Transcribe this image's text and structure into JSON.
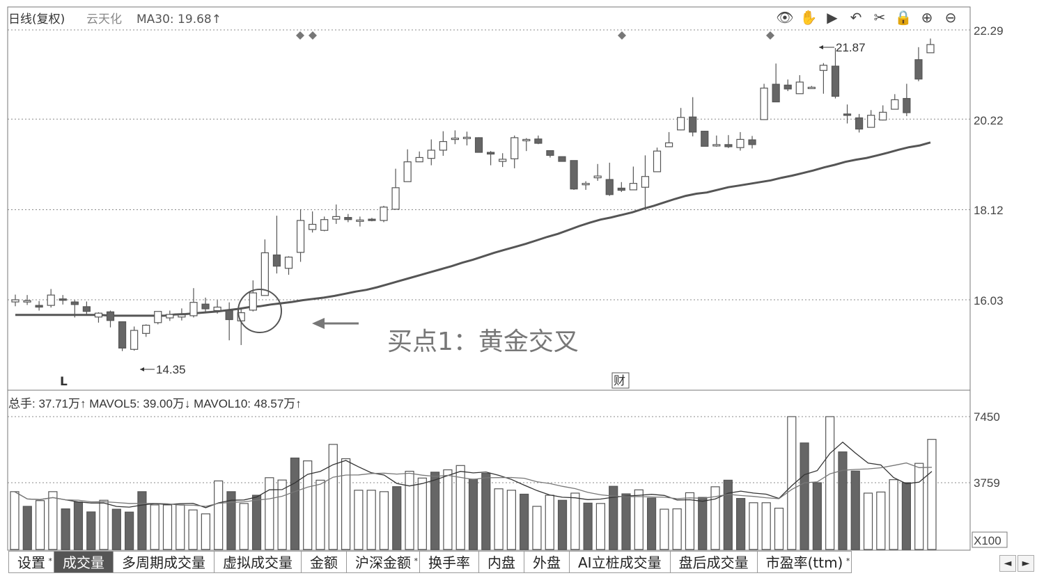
{
  "header": {
    "title": "日线(复权)",
    "stock": "云天化",
    "ma": "MA30: 19.68↑"
  },
  "toolbar": [
    {
      "name": "eye-icon",
      "glyph": "👁"
    },
    {
      "name": "hand-icon",
      "glyph": "✋"
    },
    {
      "name": "play-icon",
      "glyph": "▶"
    },
    {
      "name": "undo-icon",
      "glyph": "↶"
    },
    {
      "name": "scissors-icon",
      "glyph": "✂"
    },
    {
      "name": "lock-icon",
      "glyph": "🔒"
    },
    {
      "name": "zoom-in-icon",
      "glyph": "⊕"
    },
    {
      "name": "zoom-out-icon",
      "glyph": "⊖"
    }
  ],
  "price_axis": [
    "22.29",
    "20.22",
    "18.12",
    "16.03"
  ],
  "volume_axis": [
    "7450",
    "3759"
  ],
  "volume_unit": "X100",
  "annotations": {
    "high": "21.87",
    "low": "14.35",
    "buy_point": "买点1：黄金交叉",
    "marker_l": "L",
    "marker_cai": "财"
  },
  "volume_header": "总手: 37.71万↑ MAVOL5: 39.00万↓ MAVOL10: 48.57万↑",
  "tabs": [
    {
      "label": "设置",
      "star": "*",
      "active": false
    },
    {
      "label": "成交量",
      "star": "",
      "active": true
    },
    {
      "label": "多周期成交量",
      "star": "",
      "active": false
    },
    {
      "label": "虚拟成交量",
      "star": "",
      "active": false
    },
    {
      "label": "金额",
      "star": "",
      "active": false
    },
    {
      "label": "沪深金额",
      "star": "*",
      "active": false
    },
    {
      "label": "换手率",
      "star": "",
      "active": false
    },
    {
      "label": "内盘",
      "star": "",
      "active": false
    },
    {
      "label": "外盘",
      "star": "",
      "active": false
    },
    {
      "label": "AI立桩成交量",
      "star": "",
      "active": false
    },
    {
      "label": "盘后成交量",
      "star": "",
      "active": false
    },
    {
      "label": "市盈率(ttm)",
      "star": "*",
      "active": false
    }
  ],
  "nav": {
    "prev": "◄",
    "next": "►"
  },
  "colors": {
    "up": "#ffffff",
    "down": "#666666",
    "line": "#555555"
  },
  "chart_data": {
    "type": "candlestick",
    "ma30": 19.68,
    "candles": [
      [
        15.98,
        16.03,
        15.88,
        16.15
      ],
      [
        15.99,
        16.01,
        15.91,
        16.14
      ],
      [
        15.9,
        15.86,
        15.78,
        16.0
      ],
      [
        15.9,
        16.14,
        15.85,
        16.28
      ],
      [
        16.05,
        16.03,
        15.92,
        16.14
      ],
      [
        15.98,
        15.92,
        15.62,
        16.02
      ],
      [
        15.87,
        15.76,
        15.68,
        15.99
      ],
      [
        15.63,
        15.72,
        15.5,
        15.74
      ],
      [
        15.75,
        15.55,
        15.39,
        15.78
      ],
      [
        15.52,
        14.91,
        14.84,
        15.53
      ],
      [
        14.88,
        15.32,
        14.85,
        15.41
      ],
      [
        15.25,
        15.44,
        15.17,
        15.46
      ],
      [
        15.5,
        15.76,
        15.46,
        15.76
      ],
      [
        15.61,
        15.69,
        15.54,
        15.78
      ],
      [
        15.63,
        15.68,
        15.55,
        15.83
      ],
      [
        15.66,
        15.97,
        15.62,
        16.3
      ],
      [
        15.93,
        15.82,
        15.74,
        16.08
      ],
      [
        15.78,
        15.86,
        15.71,
        16.02
      ],
      [
        15.78,
        15.57,
        15.09,
        15.97
      ],
      [
        15.54,
        15.73,
        14.98,
        15.85
      ],
      [
        15.79,
        16.19,
        15.76,
        16.48
      ],
      [
        16.13,
        17.12,
        16.13,
        17.43
      ],
      [
        17.07,
        16.81,
        16.64,
        17.98
      ],
      [
        16.76,
        17.02,
        16.61,
        17.04
      ],
      [
        17.13,
        17.87,
        16.91,
        18.13
      ],
      [
        17.66,
        17.78,
        17.59,
        18.08
      ],
      [
        17.64,
        17.89,
        17.62,
        17.96
      ],
      [
        17.9,
        17.96,
        17.79,
        18.24
      ],
      [
        17.94,
        17.89,
        17.83,
        18.02
      ],
      [
        17.87,
        17.88,
        17.73,
        17.96
      ],
      [
        17.9,
        17.87,
        17.85,
        17.93
      ],
      [
        17.87,
        18.18,
        17.83,
        18.21
      ],
      [
        18.13,
        18.63,
        18.13,
        19.07
      ],
      [
        18.77,
        19.23,
        18.77,
        19.52
      ],
      [
        19.23,
        19.33,
        19.23,
        19.47
      ],
      [
        19.31,
        19.5,
        19.15,
        19.75
      ],
      [
        19.5,
        19.7,
        19.37,
        19.94
      ],
      [
        19.76,
        19.78,
        19.64,
        19.96
      ],
      [
        19.79,
        19.8,
        19.61,
        19.93
      ],
      [
        19.79,
        19.45,
        19.45,
        19.8
      ],
      [
        19.45,
        19.41,
        19.15,
        19.48
      ],
      [
        19.24,
        19.29,
        19.11,
        19.43
      ],
      [
        19.3,
        19.79,
        19.08,
        19.84
      ],
      [
        19.73,
        19.75,
        19.48,
        19.78
      ],
      [
        19.76,
        19.66,
        19.64,
        19.84
      ],
      [
        19.49,
        19.38,
        19.33,
        19.49
      ],
      [
        19.35,
        19.24,
        19.24,
        19.3
      ],
      [
        19.26,
        18.6,
        18.58,
        19.26
      ],
      [
        18.71,
        18.73,
        18.58,
        18.78
      ],
      [
        18.86,
        18.9,
        18.79,
        19.18
      ],
      [
        18.82,
        18.47,
        18.44,
        19.21
      ],
      [
        18.62,
        18.57,
        18.53,
        18.76
      ],
      [
        18.58,
        18.73,
        18.6,
        19.12
      ],
      [
        18.64,
        18.89,
        18.14,
        19.38
      ],
      [
        19.0,
        19.48,
        19.04,
        19.56
      ],
      [
        19.58,
        19.67,
        19.57,
        19.92
      ],
      [
        19.97,
        20.26,
        19.96,
        20.48
      ],
      [
        20.27,
        19.92,
        19.82,
        20.73
      ],
      [
        19.94,
        19.59,
        19.59,
        19.95
      ],
      [
        19.6,
        19.63,
        19.58,
        19.84
      ],
      [
        19.63,
        19.58,
        19.55,
        19.85
      ],
      [
        19.56,
        19.75,
        19.49,
        19.92
      ],
      [
        19.74,
        19.63,
        19.54,
        19.83
      ],
      [
        20.21,
        20.94,
        20.2,
        21.04
      ],
      [
        21.03,
        20.62,
        20.69,
        21.51
      ],
      [
        21.01,
        20.92,
        20.87,
        21.14
      ],
      [
        20.81,
        21.08,
        20.96,
        21.24
      ],
      [
        20.93,
        20.96,
        20.96,
        20.99
      ],
      [
        21.35,
        21.47,
        20.81,
        21.52
      ],
      [
        21.45,
        20.75,
        20.7,
        21.87
      ],
      [
        20.34,
        20.32,
        20.12,
        20.56
      ],
      [
        20.25,
        19.99,
        19.91,
        20.34
      ],
      [
        20.03,
        20.31,
        20.05,
        20.43
      ],
      [
        20.2,
        20.38,
        20.19,
        20.54
      ],
      [
        20.45,
        20.67,
        20.5,
        20.8
      ],
      [
        20.7,
        20.37,
        20.29,
        21.04
      ],
      [
        21.6,
        21.15,
        21.1,
        21.89
      ],
      [
        21.76,
        21.95,
        21.95,
        22.09
      ]
    ],
    "ma30_series": [
      15.68,
      15.68,
      15.68,
      15.68,
      15.68,
      15.68,
      15.68,
      15.68,
      15.68,
      15.66,
      15.66,
      15.66,
      15.66,
      15.66,
      15.66,
      15.69,
      15.7,
      15.72,
      15.74,
      15.76,
      15.79,
      15.82,
      15.86,
      15.88,
      15.92,
      15.95,
      15.98,
      16.02,
      16.05,
      16.08,
      16.12,
      16.17,
      16.22,
      16.26,
      16.32,
      16.39,
      16.46,
      16.53,
      16.6,
      16.67,
      16.74,
      16.81,
      16.89,
      16.96,
      17.04,
      17.12,
      17.19,
      17.26,
      17.33,
      17.41,
      17.49,
      17.56,
      17.65,
      17.74,
      17.82,
      17.89,
      17.94,
      18.0,
      18.06,
      18.14,
      18.21,
      18.29,
      18.37,
      18.44,
      18.49,
      18.52,
      18.58,
      18.64,
      18.68,
      18.72,
      18.76,
      18.8,
      18.86,
      18.91,
      18.97,
      19.03,
      19.1,
      19.16,
      19.23,
      19.28,
      19.32,
      19.38,
      19.44,
      19.51,
      19.57,
      19.61,
      19.68
    ],
    "volumes": [
      3259,
      2439,
      2759,
      3259,
      2298,
      2679,
      2128,
      2779,
      2278,
      2119,
      3259,
      2519,
      2519,
      2519,
      2238,
      2019,
      3859,
      3259,
      2599,
      3059,
      4039,
      3909,
      5139,
      4979,
      3899,
      5899,
      5099,
      3339,
      3339,
      3259,
      3539,
      4399,
      4019,
      4349,
      4479,
      4719,
      3959,
      4279,
      3419,
      3339,
      3119,
      2439,
      3059,
      2778,
      3178,
      2619,
      2599,
      3559,
      3137,
      3361,
      2898,
      2280,
      2299,
      3199,
      2938,
      3532,
      3900,
      2880,
      2641,
      2641,
      2337,
      7450,
      5980,
      3759,
      7450,
      5480,
      4410,
      3178,
      3239,
      3929,
      3760,
      4840,
      6180
    ],
    "volume_up": [
      1,
      0,
      1,
      1,
      0,
      0,
      0,
      1,
      0,
      0,
      0,
      1,
      1,
      1,
      1,
      1,
      1,
      0,
      1,
      0,
      1,
      1,
      0,
      1,
      1,
      1,
      1,
      1,
      1,
      1,
      0,
      1,
      1,
      0,
      1,
      1,
      0,
      0,
      1,
      1,
      0,
      1,
      1,
      0,
      1,
      0,
      1,
      0,
      0,
      1,
      0,
      1,
      1,
      1,
      0,
      1,
      0,
      0,
      1,
      1,
      1,
      1,
      0,
      0,
      1,
      0,
      0,
      1,
      1,
      1,
      0,
      1,
      1
    ],
    "ylim": [
      14.0,
      22.6
    ]
  }
}
